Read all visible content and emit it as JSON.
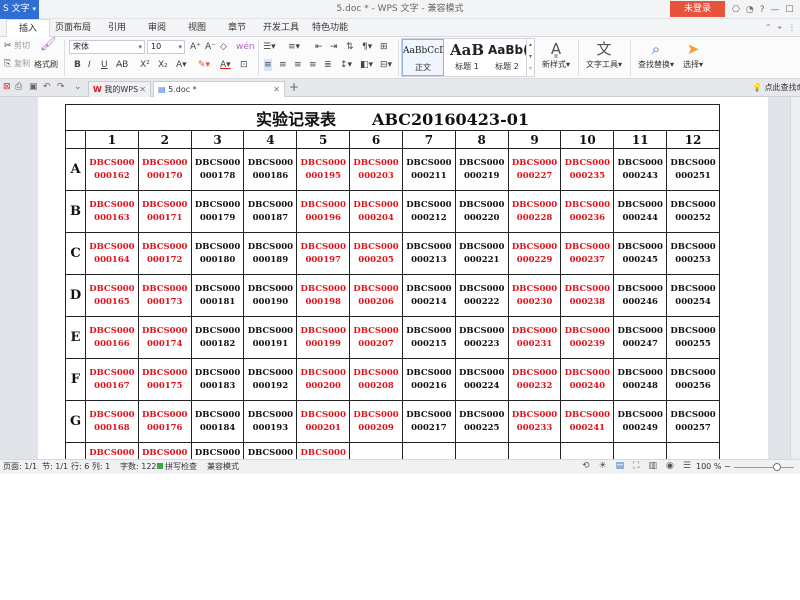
{
  "titlebar": {
    "app_menu": "S 文字",
    "caret": "▾",
    "title": "5.doc * - WPS 文字 - 兼容模式",
    "login": "未登录",
    "icons": [
      "⎔",
      "◔",
      "?",
      "—",
      "☐",
      "✕"
    ]
  },
  "menu_tabs": [
    "插入",
    "页面布局",
    "引用",
    "审阅",
    "视图",
    "章节",
    "开发工具",
    "特色功能"
  ],
  "ribbon": {
    "cut": "剪切",
    "copy": "复制",
    "format_painter": "格式刷",
    "font_name": "宋体",
    "font_size": "10",
    "styles": [
      {
        "sample": "AaBbCcD",
        "label": "正文"
      },
      {
        "sample": "AaB",
        "label": "标题 1"
      },
      {
        "sample": "AaBb(",
        "label": "标题 2"
      }
    ],
    "new_style": "新样式",
    "text_tools": "文字工具",
    "find_replace": "查找替换",
    "select": "选择"
  },
  "doc_tabs": {
    "tabs": [
      {
        "label": "我的WPS",
        "close": "✕"
      },
      {
        "label": "5.doc *",
        "close": "✕"
      }
    ],
    "add": "+",
    "tip": "点此查找命"
  },
  "document": {
    "title_left": "实验记录表",
    "title_right": "ABC20160423-01",
    "columns": [
      "1",
      "2",
      "3",
      "4",
      "5",
      "6",
      "7",
      "8",
      "9",
      "10",
      "11",
      "12"
    ],
    "rows": [
      {
        "label": "A",
        "cells": [
          {
            "l1": "DBCS000",
            "l2": "000162",
            "color": "#e0121b"
          },
          {
            "l1": "DBCS000",
            "l2": "000170",
            "color": "#e0121b"
          },
          {
            "l1": "DBCS000",
            "l2": "000178",
            "color": "#111111"
          },
          {
            "l1": "DBCS000",
            "l2": "000186",
            "color": "#111111"
          },
          {
            "l1": "DBCS000",
            "l2": "000195",
            "color": "#e0121b"
          },
          {
            "l1": "DBCS000",
            "l2": "000203",
            "color": "#e0121b"
          },
          {
            "l1": "DBCS000",
            "l2": "000211",
            "color": "#111111"
          },
          {
            "l1": "DBCS000",
            "l2": "000219",
            "color": "#111111"
          },
          {
            "l1": "DBCS000",
            "l2": "000227",
            "color": "#e0121b"
          },
          {
            "l1": "DBCS000",
            "l2": "000235",
            "color": "#e0121b"
          },
          {
            "l1": "DBCS000",
            "l2": "000243",
            "color": "#111111"
          },
          {
            "l1": "DBCS000",
            "l2": "000251",
            "color": "#111111"
          }
        ]
      },
      {
        "label": "B",
        "cells": [
          {
            "l1": "DBCS000",
            "l2": "000163",
            "color": "#e0121b"
          },
          {
            "l1": "DBCS000",
            "l2": "000171",
            "color": "#e0121b"
          },
          {
            "l1": "DBCS000",
            "l2": "000179",
            "color": "#111111"
          },
          {
            "l1": "DBCS000",
            "l2": "000187",
            "color": "#111111"
          },
          {
            "l1": "DBCS000",
            "l2": "000196",
            "color": "#e0121b"
          },
          {
            "l1": "DBCS000",
            "l2": "000204",
            "color": "#e0121b"
          },
          {
            "l1": "DBCS000",
            "l2": "000212",
            "color": "#111111"
          },
          {
            "l1": "DBCS000",
            "l2": "000220",
            "color": "#111111"
          },
          {
            "l1": "DBCS000",
            "l2": "000228",
            "color": "#e0121b"
          },
          {
            "l1": "DBCS000",
            "l2": "000236",
            "color": "#e0121b"
          },
          {
            "l1": "DBCS000",
            "l2": "000244",
            "color": "#111111"
          },
          {
            "l1": "DBCS000",
            "l2": "000252",
            "color": "#111111"
          }
        ]
      },
      {
        "label": "C",
        "cells": [
          {
            "l1": "DBCS000",
            "l2": "000164",
            "color": "#e0121b"
          },
          {
            "l1": "DBCS000",
            "l2": "000172",
            "color": "#e0121b"
          },
          {
            "l1": "DBCS000",
            "l2": "000180",
            "color": "#111111"
          },
          {
            "l1": "DBCS000",
            "l2": "000189",
            "color": "#111111"
          },
          {
            "l1": "DBCS000",
            "l2": "000197",
            "color": "#e0121b"
          },
          {
            "l1": "DBCS000",
            "l2": "000205",
            "color": "#e0121b"
          },
          {
            "l1": "DBCS000",
            "l2": "000213",
            "color": "#111111"
          },
          {
            "l1": "DBCS000",
            "l2": "000221",
            "color": "#111111"
          },
          {
            "l1": "DBCS000",
            "l2": "000229",
            "color": "#e0121b"
          },
          {
            "l1": "DBCS000",
            "l2": "000237",
            "color": "#e0121b"
          },
          {
            "l1": "DBCS000",
            "l2": "000245",
            "color": "#111111"
          },
          {
            "l1": "DBCS000",
            "l2": "000253",
            "color": "#111111"
          }
        ]
      },
      {
        "label": "D",
        "cells": [
          {
            "l1": "DBCS000",
            "l2": "000165",
            "color": "#e0121b"
          },
          {
            "l1": "DBCS000",
            "l2": "000173",
            "color": "#e0121b"
          },
          {
            "l1": "DBCS000",
            "l2": "000181",
            "color": "#111111"
          },
          {
            "l1": "DBCS000",
            "l2": "000190",
            "color": "#111111"
          },
          {
            "l1": "DBCS000",
            "l2": "000198",
            "color": "#e0121b"
          },
          {
            "l1": "DBCS000",
            "l2": "000206",
            "color": "#e0121b"
          },
          {
            "l1": "DBCS000",
            "l2": "000214",
            "color": "#111111"
          },
          {
            "l1": "DBCS000",
            "l2": "000222",
            "color": "#111111"
          },
          {
            "l1": "DBCS000",
            "l2": "000230",
            "color": "#e0121b"
          },
          {
            "l1": "DBCS000",
            "l2": "000238",
            "color": "#e0121b"
          },
          {
            "l1": "DBCS000",
            "l2": "000246",
            "color": "#111111"
          },
          {
            "l1": "DBCS000",
            "l2": "000254",
            "color": "#111111"
          }
        ]
      },
      {
        "label": "E",
        "cells": [
          {
            "l1": "DBCS000",
            "l2": "000166",
            "color": "#e0121b"
          },
          {
            "l1": "DBCS000",
            "l2": "000174",
            "color": "#e0121b"
          },
          {
            "l1": "DBCS000",
            "l2": "000182",
            "color": "#111111"
          },
          {
            "l1": "DBCS000",
            "l2": "000191",
            "color": "#111111"
          },
          {
            "l1": "DBCS000",
            "l2": "000199",
            "color": "#e0121b"
          },
          {
            "l1": "DBCS000",
            "l2": "000207",
            "color": "#e0121b"
          },
          {
            "l1": "DBCS000",
            "l2": "000215",
            "color": "#111111"
          },
          {
            "l1": "DBCS000",
            "l2": "000223",
            "color": "#111111"
          },
          {
            "l1": "DBCS000",
            "l2": "000231",
            "color": "#e0121b"
          },
          {
            "l1": "DBCS000",
            "l2": "000239",
            "color": "#e0121b"
          },
          {
            "l1": "DBCS000",
            "l2": "000247",
            "color": "#111111"
          },
          {
            "l1": "DBCS000",
            "l2": "000255",
            "color": "#111111"
          }
        ]
      },
      {
        "label": "F",
        "cells": [
          {
            "l1": "DBCS000",
            "l2": "000167",
            "color": "#e0121b"
          },
          {
            "l1": "DBCS000",
            "l2": "000175",
            "color": "#e0121b"
          },
          {
            "l1": "DBCS000",
            "l2": "000183",
            "color": "#111111"
          },
          {
            "l1": "DBCS000",
            "l2": "000192",
            "color": "#111111"
          },
          {
            "l1": "DBCS000",
            "l2": "000200",
            "color": "#e0121b"
          },
          {
            "l1": "DBCS000",
            "l2": "000208",
            "color": "#e0121b"
          },
          {
            "l1": "DBCS000",
            "l2": "000216",
            "color": "#111111"
          },
          {
            "l1": "DBCS000",
            "l2": "000224",
            "color": "#111111"
          },
          {
            "l1": "DBCS000",
            "l2": "000232",
            "color": "#e0121b"
          },
          {
            "l1": "DBCS000",
            "l2": "000240",
            "color": "#e0121b"
          },
          {
            "l1": "DBCS000",
            "l2": "000248",
            "color": "#111111"
          },
          {
            "l1": "DBCS000",
            "l2": "000256",
            "color": "#111111"
          }
        ]
      },
      {
        "label": "G",
        "cells": [
          {
            "l1": "DBCS000",
            "l2": "000168",
            "color": "#e0121b"
          },
          {
            "l1": "DBCS000",
            "l2": "000176",
            "color": "#e0121b"
          },
          {
            "l1": "DBCS000",
            "l2": "000184",
            "color": "#111111"
          },
          {
            "l1": "DBCS000",
            "l2": "000193",
            "color": "#111111"
          },
          {
            "l1": "DBCS000",
            "l2": "000201",
            "color": "#e0121b"
          },
          {
            "l1": "DBCS000",
            "l2": "000209",
            "color": "#e0121b"
          },
          {
            "l1": "DBCS000",
            "l2": "000217",
            "color": "#111111"
          },
          {
            "l1": "DBCS000",
            "l2": "000225",
            "color": "#111111"
          },
          {
            "l1": "DBCS000",
            "l2": "000233",
            "color": "#e0121b"
          },
          {
            "l1": "DBCS000",
            "l2": "000241",
            "color": "#e0121b"
          },
          {
            "l1": "DBCS000",
            "l2": "000249",
            "color": "#111111"
          },
          {
            "l1": "DBCS000",
            "l2": "000257",
            "color": "#111111"
          }
        ]
      }
    ],
    "partial_row": [
      {
        "l1": "DBCS000",
        "color": "#e0121b"
      },
      {
        "l1": "DBCS000",
        "color": "#e0121b"
      },
      {
        "l1": "DBCS000",
        "color": "#111111"
      },
      {
        "l1": "DBCS000",
        "color": "#111111"
      },
      {
        "l1": "DBCS000",
        "color": "#e0121b"
      }
    ]
  },
  "statusbar": {
    "page": "页面: 1/1",
    "section": "节: 1/1",
    "row_col": "行: 6  列: 1",
    "words": "字数: 122",
    "spell": "拼写检查",
    "compat": "兼容模式",
    "zoom": "100 %"
  },
  "colors": {
    "accent": "#2f6ed2",
    "login": "#e7533a",
    "red_text": "#e0121b"
  }
}
